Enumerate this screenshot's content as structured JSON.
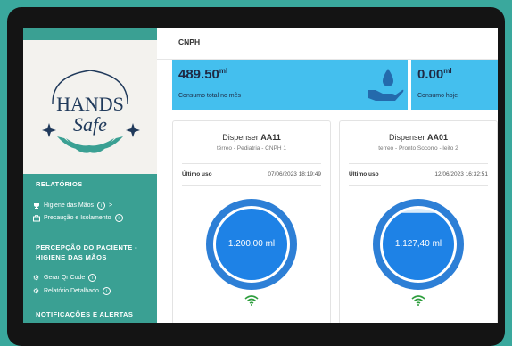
{
  "header": {
    "title": "CNPH"
  },
  "stats": [
    {
      "value": "489.50",
      "unit": "ml",
      "label": "Consumo total no mês"
    },
    {
      "value": "0.00",
      "unit": "ml",
      "label": "Consumo hoje"
    }
  ],
  "sidebar": {
    "logo_line1": "HANDS",
    "logo_line2": "Safe",
    "sections": [
      {
        "title": "RELATÓRIOS"
      },
      {
        "title_line1": "PERCEPÇÃO DO PACIENTE -",
        "title_line2": "HIGIENE DAS MÃOS"
      },
      {
        "title": "NOTIFICAÇÕES E ALERTAS"
      }
    ],
    "items": [
      {
        "label": "Higiene das Mãos",
        "icon": "trophy-icon",
        "extra": ">"
      },
      {
        "label": "Precaução e Isolamento",
        "icon": "briefcase-icon"
      },
      {
        "label": "Gerar Qr Code",
        "icon": "gear-icon"
      },
      {
        "label": "Relatório Detalhado",
        "icon": "gear-icon"
      }
    ]
  },
  "dispensers": [
    {
      "prefix": "Dispenser ",
      "code": "AA11",
      "location": "térreo - Pediatria - CNPH 1",
      "last_use_label": "Último uso",
      "last_use": "07/06/2023 18:19:49",
      "volume": "1.200,00 ml",
      "fill_fraction": 1.0
    },
    {
      "prefix": "Dispenser ",
      "code": "AA01",
      "location": "terreo - Pronto Socorro - leito 2",
      "last_use_label": "Último uso",
      "last_use": "12/06/2023 16:32:51",
      "volume": "1.127,40 ml",
      "fill_fraction": 0.94
    }
  ],
  "colors": {
    "teal": "#3aa093",
    "stat_blue": "#44bfee",
    "gauge_blue": "#1e82e6",
    "ring": "#2d7fd6",
    "wifi": "#2e9e3e"
  },
  "carousel": {
    "prev_arrow": "‹"
  }
}
